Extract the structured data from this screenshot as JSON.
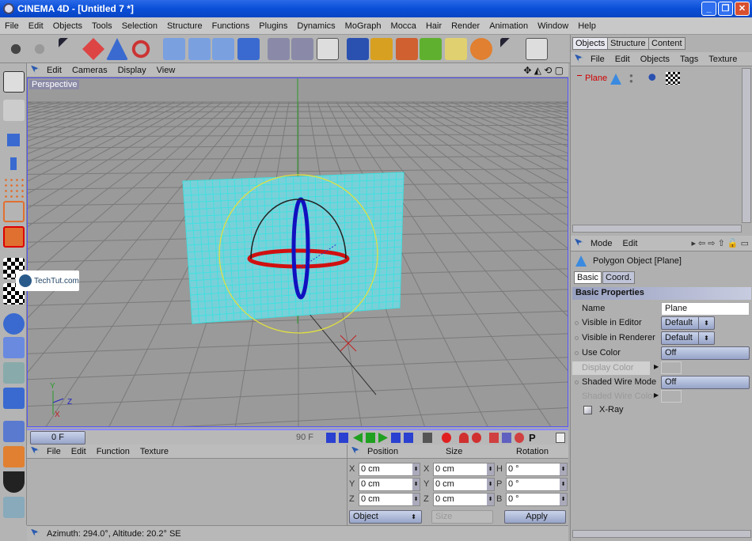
{
  "window": {
    "title": "CINEMA 4D - [Untitled 7 *]",
    "controls": [
      "_",
      "❐",
      "✕"
    ]
  },
  "menu": [
    "File",
    "Edit",
    "Objects",
    "Tools",
    "Selection",
    "Structure",
    "Functions",
    "Plugins",
    "Dynamics",
    "MoGraph",
    "Mocca",
    "Hair",
    "Render",
    "Animation",
    "Window",
    "Help"
  ],
  "viewport": {
    "menu": [
      "Edit",
      "Cameras",
      "Display",
      "View"
    ],
    "camera_label": "Perspective",
    "axes": {
      "y": "Y",
      "z": "Z",
      "x": "X"
    }
  },
  "watermark": "TechTut.com",
  "timeline": {
    "current_frame": "0 F",
    "end_frame": "90 F"
  },
  "material_manager": {
    "menu": [
      "File",
      "Edit",
      "Function",
      "Texture"
    ]
  },
  "coordinates": {
    "headers": [
      "Position",
      "Size",
      "Rotation"
    ],
    "position": [
      {
        "axis": "X",
        "value": "0 cm"
      },
      {
        "axis": "Y",
        "value": "0 cm"
      },
      {
        "axis": "Z",
        "value": "0 cm"
      }
    ],
    "size": [
      {
        "axis": "X",
        "value": "0 cm"
      },
      {
        "axis": "Y",
        "value": "0 cm"
      },
      {
        "axis": "Z",
        "value": "0 cm"
      }
    ],
    "rotation": [
      {
        "axis": "H",
        "value": "0 °"
      },
      {
        "axis": "P",
        "value": "0 °"
      },
      {
        "axis": "B",
        "value": "0 °"
      }
    ],
    "mode": "Object",
    "size_mode": "Size",
    "apply": "Apply"
  },
  "status": "Azimuth: 294.0°, Altitude: 20.2°  SE",
  "objects": {
    "tabs": [
      "Objects",
      "Structure",
      "Content"
    ],
    "menu": [
      "File",
      "Edit",
      "Objects",
      "Tags",
      "Texture"
    ],
    "items": [
      {
        "name": "Plane"
      }
    ]
  },
  "attributes": {
    "menu": [
      "Mode",
      "Edit"
    ],
    "object_title": "Polygon Object [Plane]",
    "tabs": [
      "Basic",
      "Coord."
    ],
    "section": "Basic Properties",
    "props": [
      {
        "label": "Name",
        "value": "Plane"
      },
      {
        "label": "Visible in Editor",
        "value": "Default"
      },
      {
        "label": "Visible in Renderer",
        "value": "Default"
      },
      {
        "label": "Use Color",
        "value": "Off"
      },
      {
        "label": "Display Color",
        "value": ""
      },
      {
        "label": "Shaded Wire Mode",
        "value": "Off"
      },
      {
        "label": "Shaded Wire Color",
        "value": ""
      }
    ],
    "xray": "X-Ray"
  },
  "colors": {
    "title_bar": "#0a4fd8",
    "plane_wire": "#40e0e0",
    "gizmo_ring": "#e0e040",
    "axis_x": "#d01010",
    "axis_y": "#1010c0"
  }
}
